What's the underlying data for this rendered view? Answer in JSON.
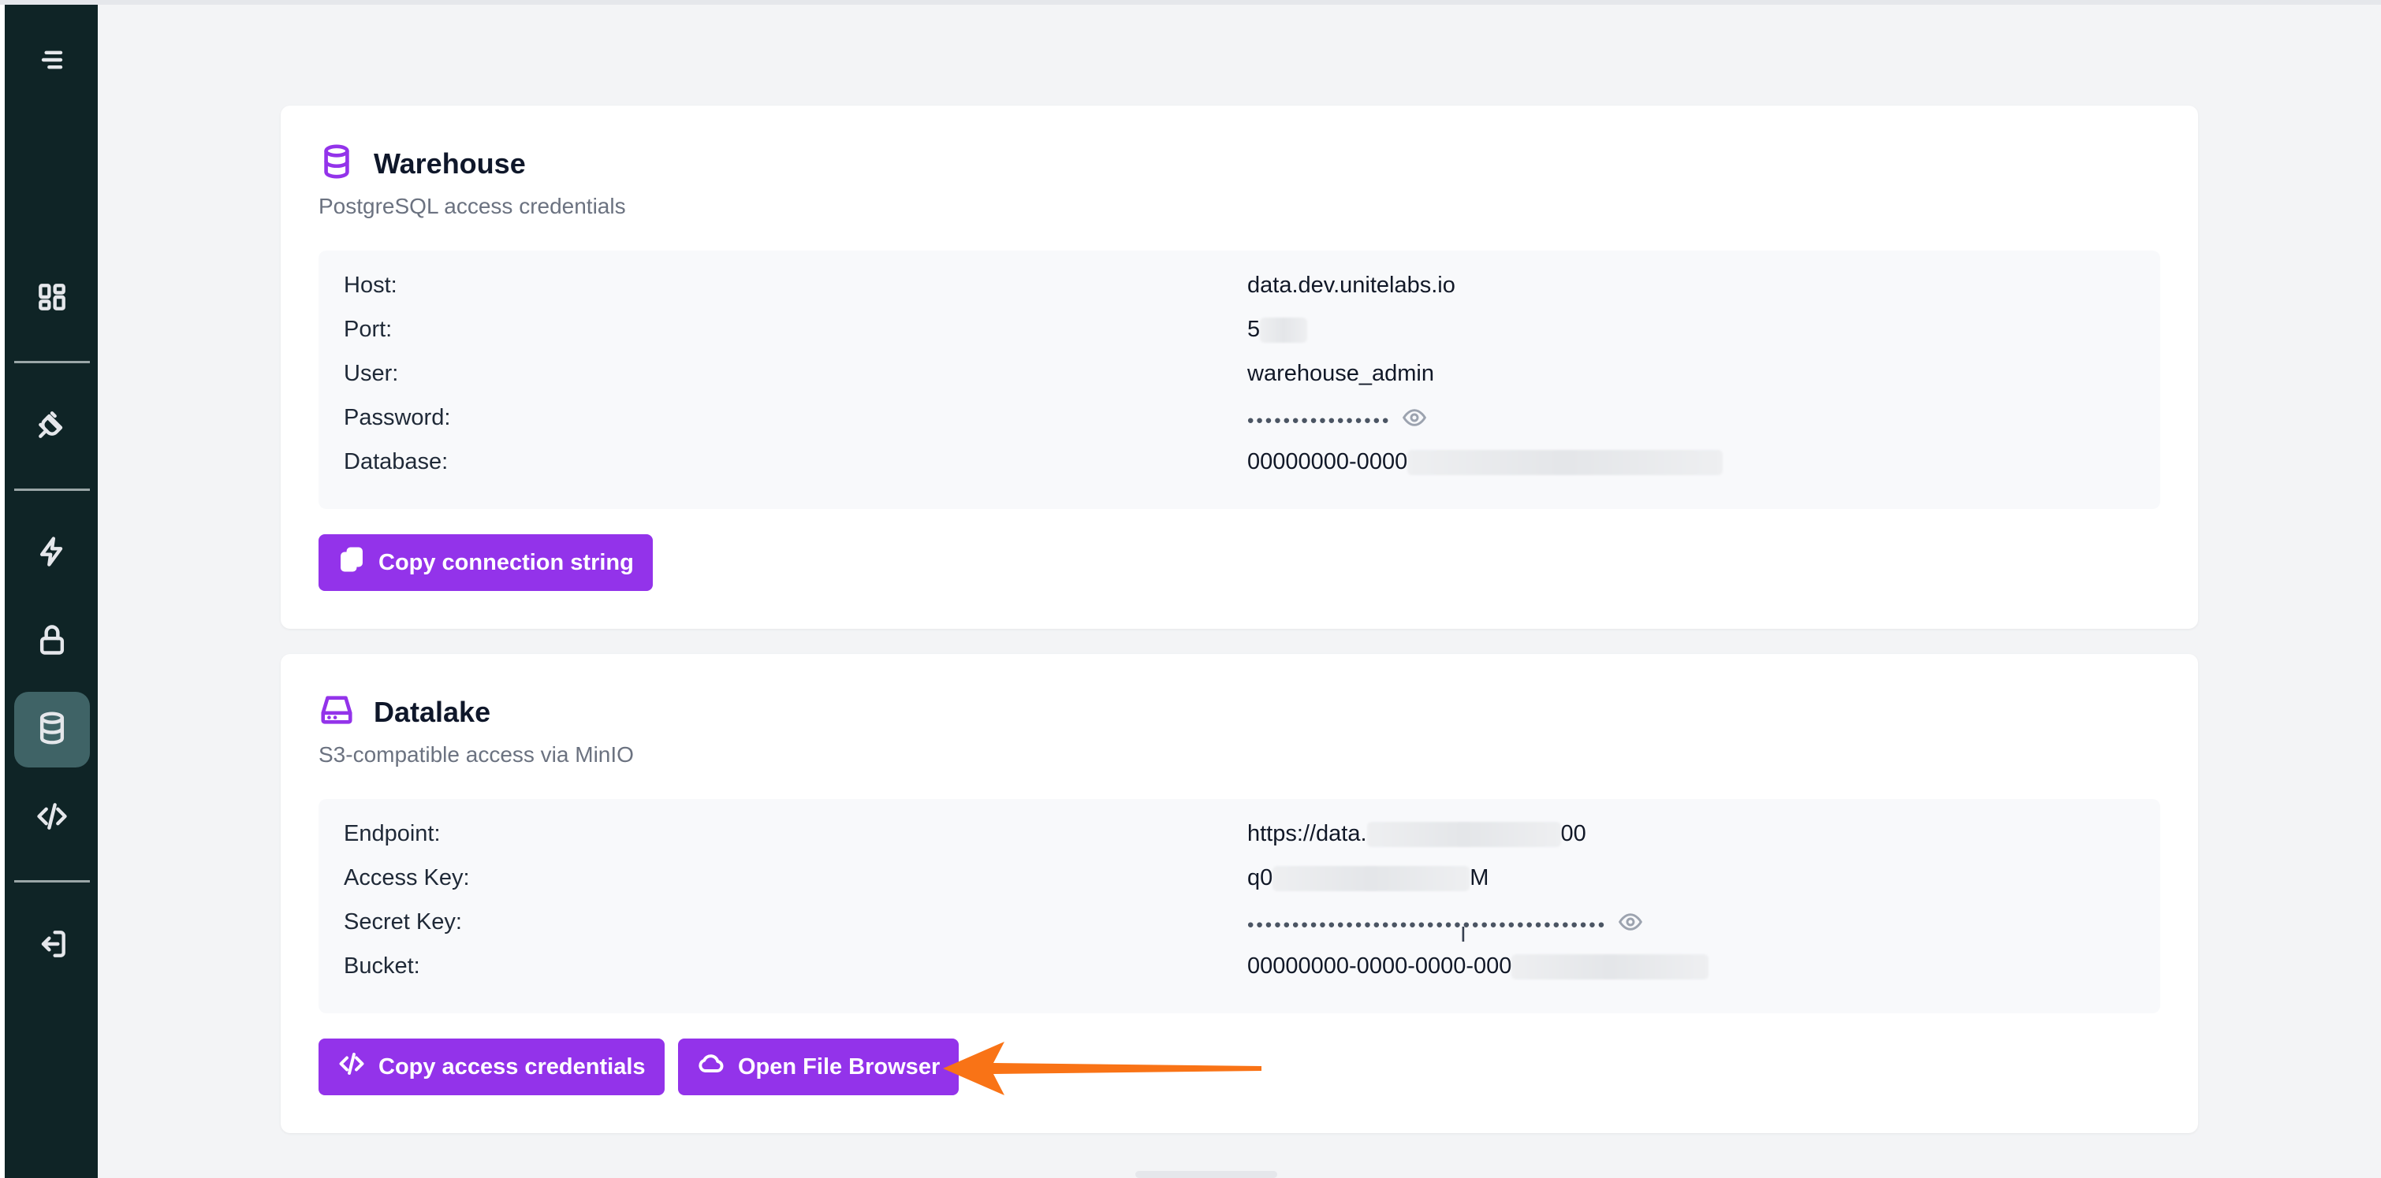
{
  "colors": {
    "accent": "#9333ea",
    "sidebar_bg": "#0f2426",
    "annotation_arrow": "#f97316"
  },
  "sidebar": {
    "items": [
      {
        "icon": "menu-icon"
      },
      {
        "icon": "dashboard-icon"
      },
      {
        "icon": "plug-icon"
      },
      {
        "icon": "lightning-icon"
      },
      {
        "icon": "lock-icon"
      },
      {
        "icon": "database-icon",
        "active": true
      },
      {
        "icon": "code-icon"
      },
      {
        "icon": "logout-icon"
      }
    ]
  },
  "warehouse": {
    "title": "Warehouse",
    "subtitle": "PostgreSQL access credentials",
    "icon": "database-icon",
    "fields": [
      {
        "label": "Host:",
        "value": "data.dev.unitelabs.io"
      },
      {
        "label": "Port:",
        "value": "5"
      },
      {
        "label": "User:",
        "value": "warehouse_admin"
      },
      {
        "label": "Password:",
        "value": "••••••••••••••••"
      },
      {
        "label": "Database:",
        "value": "00000000-0000"
      }
    ],
    "copy_button": "Copy connection string"
  },
  "datalake": {
    "title": "Datalake",
    "subtitle": "S3-compatible access via MinIO",
    "icon": "hard-drive-icon",
    "fields": [
      {
        "label": "Endpoint:",
        "value_start": "https://data.",
        "value_end": "00"
      },
      {
        "label": "Access Key:",
        "value_start": "q0",
        "value_end": "M"
      },
      {
        "label": "Secret Key:",
        "value": "••••••••••••••••••••••••••••••••••••••••"
      },
      {
        "label": "Bucket:",
        "value": "00000000-0000-0000-000"
      }
    ],
    "copy_button": "Copy access credentials",
    "browser_button": "Open File Browser"
  }
}
